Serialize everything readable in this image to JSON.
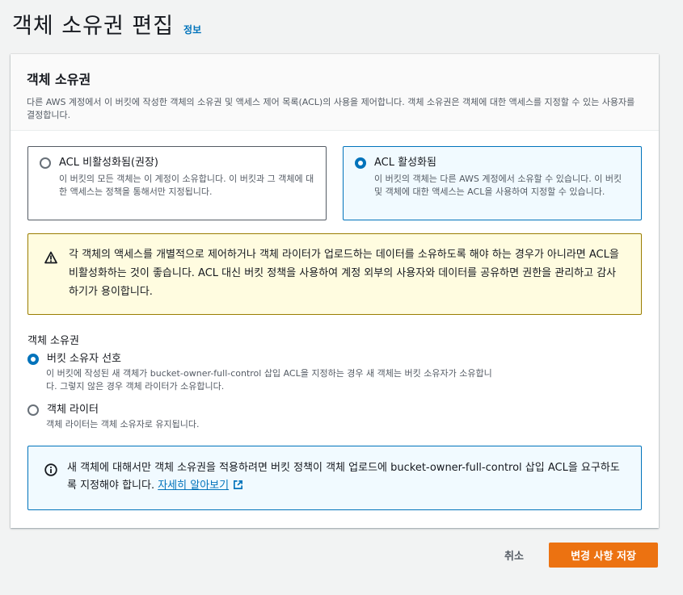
{
  "header": {
    "title": "객체 소유권 편집",
    "info_link": "정보"
  },
  "panel": {
    "title": "객체 소유권",
    "description": "다른 AWS 계정에서 이 버킷에 작성한 객체의 소유권 및 액세스 제어 목록(ACL)의 사용을 제어합니다. 객체 소유권은 객체에 대한 액세스를 지정할 수 있는 사용자를 결정합니다."
  },
  "acl_tiles": [
    {
      "label": "ACL 비활성화됨(권장)",
      "description": "이 버킷의 모든 객체는 이 계정이 소유합니다. 이 버킷과 그 객체에 대한 액세스는 정책을 통해서만 지정됩니다.",
      "selected": false
    },
    {
      "label": "ACL 활성화됨",
      "description": "이 버킷의 객체는 다른 AWS 계정에서 소유할 수 있습니다. 이 버킷 및 객체에 대한 액세스는 ACL을 사용하여 지정할 수 있습니다.",
      "selected": true
    }
  ],
  "warning": {
    "icon": "warning-triangle-icon",
    "text": "각 객체의 액세스를 개별적으로 제어하거나 객체 라이터가 업로드하는 데이터를 소유하도록 해야 하는 경우가 아니라면 ACL을 비활성화하는 것이 좋습니다. ACL 대신 버킷 정책을 사용하여 계정 외부의 사용자와 데이터를 공유하면 권한을 관리하고 감사하기가 용이합니다."
  },
  "ownership": {
    "label": "객체 소유권",
    "options": [
      {
        "label": "버킷 소유자 선호",
        "description": "이 버킷에 작성된 새 객체가 bucket-owner-full-control 삽입 ACL을 지정하는 경우 새 객체는 버킷 소유자가 소유합니다. 그렇지 않은 경우 객체 라이터가 소유합니다.",
        "selected": true
      },
      {
        "label": "객체 라이터",
        "description": "객체 라이터는 객체 소유자로 유지됩니다.",
        "selected": false
      }
    ]
  },
  "info": {
    "icon": "info-circle-icon",
    "text": "새 객체에 대해서만 객체 소유권을 적용하려면 버킷 정책이 객체 업로드에 bucket-owner-full-control 삽입 ACL을 요구하도록 지정해야 합니다.",
    "link_label": "자세히 알아보기"
  },
  "actions": {
    "cancel_label": "취소",
    "save_label": "변경 사항 저장"
  },
  "colors": {
    "accent": "#0073bb",
    "primary_button": "#ec7211",
    "warning_bg": "#fffce0",
    "info_bg": "#f1faff"
  }
}
